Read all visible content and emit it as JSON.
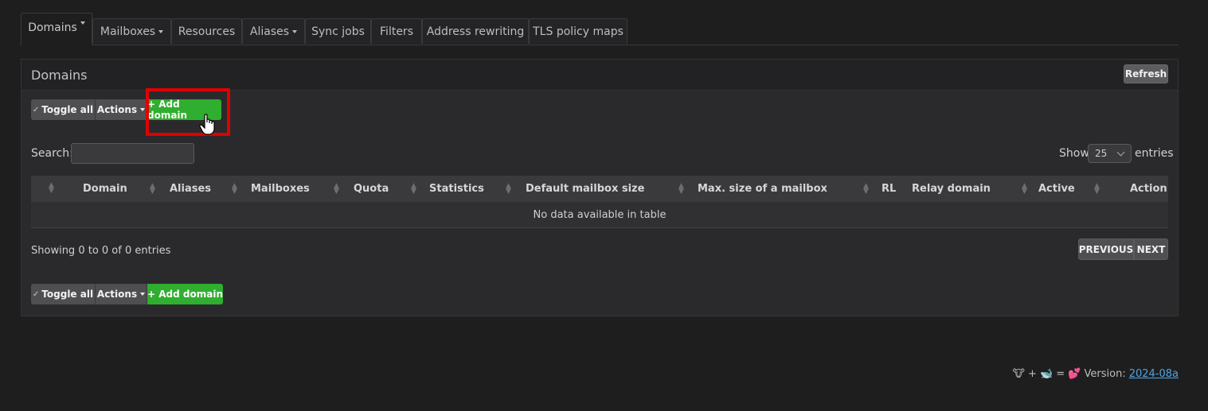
{
  "tabs": [
    {
      "label": "Domains",
      "dropdown": true
    },
    {
      "label": "Mailboxes",
      "dropdown": true
    },
    {
      "label": "Resources",
      "dropdown": false
    },
    {
      "label": "Aliases",
      "dropdown": true
    },
    {
      "label": "Sync jobs",
      "dropdown": false
    },
    {
      "label": "Filters",
      "dropdown": false
    },
    {
      "label": "Address rewriting",
      "dropdown": false
    },
    {
      "label": "TLS policy maps",
      "dropdown": false
    }
  ],
  "panel": {
    "title": "Domains",
    "refresh_label": "Refresh"
  },
  "toolbar": {
    "toggle_all": "Toggle all",
    "actions": "Actions",
    "add_domain": "+ Add domain"
  },
  "search": {
    "label": "Search:",
    "value": ""
  },
  "length": {
    "show": "Show",
    "value": "25",
    "entries": "entries"
  },
  "table": {
    "columns": [
      "",
      "Domain",
      "Aliases",
      "Mailboxes",
      "Quota",
      "Statistics",
      "Default mailbox size",
      "Max. size of a mailbox",
      "RL",
      "Relay domain",
      "Active",
      "Action"
    ],
    "empty_message": "No data available in table"
  },
  "info": "Showing 0 to 0 of 0 entries",
  "pager": {
    "previous": "PREVIOUS",
    "next": "NEXT"
  },
  "footer": {
    "emoji": "🐮 + 🐋 = 💕",
    "version_label": "Version:",
    "version": "2024-08a"
  },
  "colors": {
    "accent": "#2fae2f",
    "highlight": "#e00000",
    "link": "#4fa3e0"
  }
}
